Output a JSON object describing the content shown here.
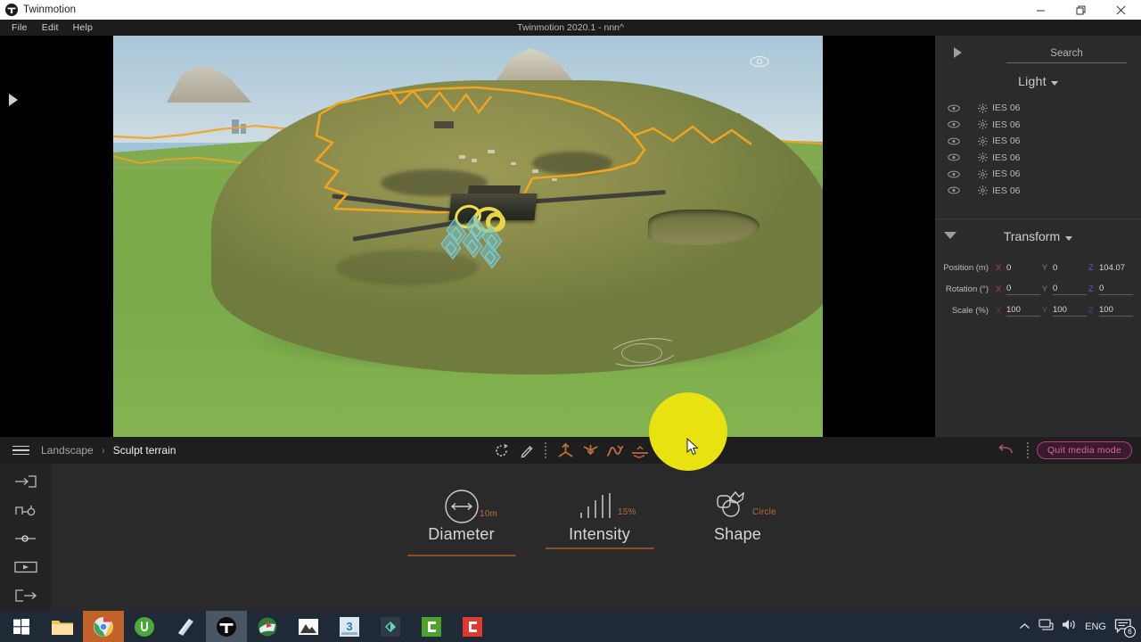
{
  "window": {
    "app_name": "Twinmotion",
    "document_title": "Twinmotion 2020.1 - nnn^",
    "minimize_label": "–",
    "restore_label": "❐",
    "close_label": "✕"
  },
  "menu": {
    "items": [
      {
        "label": "File"
      },
      {
        "label": "Edit"
      },
      {
        "label": "Help"
      }
    ]
  },
  "viewport": {
    "eye_icon": "eye-icon",
    "expand_icon": "expand-panel-triangle-icon"
  },
  "right_panel": {
    "collapse_icon": "triangle-right-icon",
    "search": {
      "label": "Search",
      "placeholder": "Search"
    },
    "scene_section": {
      "title": "Light",
      "caret": "caret-down-icon",
      "items": [
        {
          "name": "IES 06",
          "visibility_icon": "eye-icon",
          "type_icon": "light-icon"
        },
        {
          "name": "IES 06",
          "visibility_icon": "eye-icon",
          "type_icon": "light-icon"
        },
        {
          "name": "IES 06",
          "visibility_icon": "eye-icon",
          "type_icon": "light-icon"
        },
        {
          "name": "IES 06",
          "visibility_icon": "eye-icon",
          "type_icon": "light-icon"
        },
        {
          "name": "IES 06",
          "visibility_icon": "eye-icon",
          "type_icon": "light-icon"
        },
        {
          "name": "IES 06",
          "visibility_icon": "eye-icon",
          "type_icon": "light-icon"
        }
      ]
    },
    "transform": {
      "title": "Transform",
      "expand_icon": "triangle-down-icon",
      "caret": "caret-down-icon",
      "rows": [
        {
          "label": "Position (m)",
          "axes": [
            {
              "axis": "X",
              "value": "0"
            },
            {
              "axis": "Y",
              "value": "0"
            },
            {
              "axis": "Z",
              "value": "104.07"
            }
          ]
        },
        {
          "label": "Rotation (°)",
          "axes": [
            {
              "axis": "X",
              "value": "0"
            },
            {
              "axis": "Y",
              "value": "0"
            },
            {
              "axis": "Z",
              "value": "0"
            }
          ]
        },
        {
          "label": "Scale (%)",
          "axes": [
            {
              "axis": "X",
              "value": "100"
            },
            {
              "axis": "Y",
              "value": "100"
            },
            {
              "axis": "Z",
              "value": "100"
            }
          ]
        }
      ]
    }
  },
  "toolbar": {
    "menu_icon": "hamburger-menu-icon",
    "breadcrumb": {
      "parent": "Landscape",
      "separator": "›",
      "current": "Sculpt terrain"
    },
    "tools": [
      {
        "name": "reset-tool",
        "icon": "refresh-icon"
      },
      {
        "name": "paint-tool",
        "icon": "pencil-icon"
      },
      {
        "name": "raise-terrain-tool",
        "icon": "raise-icon"
      },
      {
        "name": "lower-terrain-tool",
        "icon": "lower-icon"
      },
      {
        "name": "smooth-terrain-tool",
        "icon": "smooth-icon"
      },
      {
        "name": "flatten-terrain-tool",
        "icon": "flatten-icon"
      }
    ],
    "undo_icon": "undo-arrow-icon",
    "quit_media_mode": "Quit media mode"
  },
  "left_rail": {
    "items": [
      {
        "name": "import-icon"
      },
      {
        "name": "path-keyframe-icon"
      },
      {
        "name": "slider-icon"
      },
      {
        "name": "media-player-icon"
      },
      {
        "name": "export-icon"
      }
    ]
  },
  "brush_settings": {
    "options": [
      {
        "name": "Diameter",
        "value": "10m",
        "icon": "diameter-arrow-icon"
      },
      {
        "name": "Intensity",
        "value": "15%",
        "icon": "intensity-bars-icon"
      },
      {
        "name": "Shape",
        "value": "Circle",
        "icon": "shape-cloud-icon"
      }
    ],
    "accent_color": "#b5693e"
  },
  "cursor": {
    "brush_color": "#e8e211",
    "pointer_icon": "mouse-pointer-icon"
  },
  "taskbar": {
    "start": {
      "name": "start-button",
      "icon": "windows-logo-icon"
    },
    "apps": [
      {
        "name": "file-explorer",
        "icon": "folder-icon",
        "active": false
      },
      {
        "name": "google-chrome",
        "icon": "chrome-icon",
        "active": true
      },
      {
        "name": "utorrent",
        "icon": "utorrent-icon",
        "active": false
      },
      {
        "name": "onenote",
        "icon": "notebook-icon",
        "active": false
      },
      {
        "name": "twinmotion",
        "icon": "twinmotion-logo-icon",
        "active": true
      },
      {
        "name": "internet-download-manager",
        "icon": "idm-icon",
        "active": false
      },
      {
        "name": "photos",
        "icon": "photos-icon",
        "active": false
      },
      {
        "name": "3ds-max",
        "icon": "3dsmax-icon",
        "active": false
      },
      {
        "name": "everything-search",
        "icon": "everything-icon",
        "active": false
      },
      {
        "name": "c-app-green",
        "icon": "c-green-icon",
        "active": false
      },
      {
        "name": "c-app-red",
        "icon": "c-red-icon",
        "active": false
      }
    ],
    "tray": {
      "chevron": "chevron-up-icon",
      "network": "network-icon",
      "volume": "volume-icon",
      "language": "ENG",
      "notifications": {
        "icon": "action-center-icon",
        "count": "6"
      }
    }
  }
}
